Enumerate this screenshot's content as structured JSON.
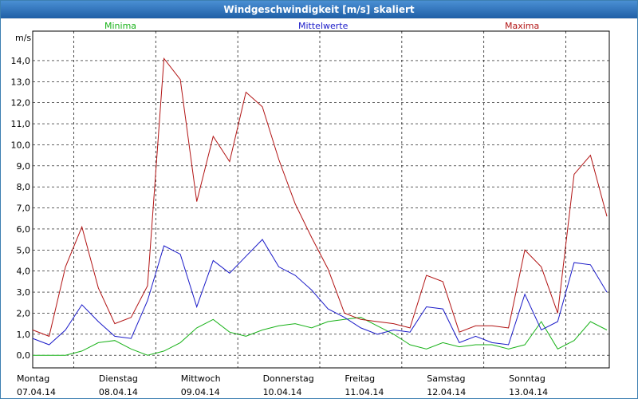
{
  "window": {
    "title": "Windgeschwindigkeit [m/s] skaliert"
  },
  "colors": {
    "min": "#19b219",
    "mean": "#1a1ac8",
    "max": "#b21414",
    "grid": "#000000"
  },
  "chart_data": {
    "type": "line",
    "title": "Windgeschwindigkeit [m/s] skaliert",
    "ylabel": "m/s",
    "ylim": [
      -0.6,
      15.4
    ],
    "yticks": [
      "0,0",
      "1,0",
      "2,0",
      "3,0",
      "4,0",
      "5,0",
      "6,0",
      "7,0",
      "8,0",
      "9,0",
      "10,0",
      "11,0",
      "12,0",
      "13,0",
      "14,0"
    ],
    "grid": true,
    "legend_position": "top",
    "day_labels": [
      {
        "weekday": "Montag",
        "date": "07.04.14"
      },
      {
        "weekday": "Dienstag",
        "date": "08.04.14"
      },
      {
        "weekday": "Mittwoch",
        "date": "09.04.14"
      },
      {
        "weekday": "Donnerstag",
        "date": "10.04.14"
      },
      {
        "weekday": "Freitag",
        "date": "11.04.14"
      },
      {
        "weekday": "Samstag",
        "date": "12.04.14"
      },
      {
        "weekday": "Sonntag",
        "date": "13.04.14"
      }
    ],
    "series": [
      {
        "name": "Minima",
        "key": "min",
        "x": [
          0,
          0.2,
          0.4,
          0.6,
          0.8,
          1,
          1.2,
          1.4,
          1.6,
          1.8,
          2,
          2.2,
          2.4,
          2.6,
          2.8,
          3,
          3.2,
          3.4,
          3.6,
          3.8,
          4,
          4.2,
          4.4,
          4.6,
          4.8,
          5,
          5.2,
          5.4,
          5.6,
          5.8,
          6,
          6.2,
          6.4,
          6.6,
          6.8,
          7
        ],
        "y": [
          0,
          0,
          0,
          0.2,
          0.6,
          0.7,
          0.3,
          0,
          0.2,
          0.6,
          1.3,
          1.7,
          1.1,
          0.9,
          1.2,
          1.4,
          1.5,
          1.3,
          1.6,
          1.7,
          1.8,
          1.4,
          1.0,
          0.5,
          0.3,
          0.6,
          0.4,
          0.5,
          0.5,
          0.3,
          0.5,
          1.6,
          0.3,
          0.7,
          1.6,
          1.2
        ]
      },
      {
        "name": "Mittelwerte",
        "key": "mean",
        "x": [
          0,
          0.2,
          0.4,
          0.6,
          0.8,
          1,
          1.2,
          1.4,
          1.6,
          1.8,
          2,
          2.2,
          2.4,
          2.6,
          2.8,
          3,
          3.2,
          3.4,
          3.6,
          3.8,
          4,
          4.2,
          4.4,
          4.6,
          4.8,
          5,
          5.2,
          5.4,
          5.6,
          5.8,
          6,
          6.2,
          6.4,
          6.6,
          6.8,
          7
        ],
        "y": [
          0.8,
          0.5,
          1.2,
          2.4,
          1.6,
          0.9,
          0.8,
          2.6,
          5.2,
          4.8,
          2.3,
          4.5,
          3.9,
          4.7,
          5.5,
          4.2,
          3.8,
          3.1,
          2.2,
          1.8,
          1.3,
          1.0,
          1.2,
          1.1,
          2.3,
          2.2,
          0.6,
          0.9,
          0.6,
          0.5,
          2.9,
          1.2,
          1.6,
          4.4,
          4.3,
          3.0
        ]
      },
      {
        "name": "Maxima",
        "key": "max",
        "x": [
          0,
          0.2,
          0.4,
          0.6,
          0.8,
          1,
          1.2,
          1.4,
          1.6,
          1.8,
          2,
          2.2,
          2.4,
          2.6,
          2.8,
          3,
          3.2,
          3.4,
          3.6,
          3.8,
          4,
          4.2,
          4.4,
          4.6,
          4.8,
          5,
          5.2,
          5.4,
          5.6,
          5.8,
          6,
          6.2,
          6.4,
          6.6,
          6.8,
          7
        ],
        "y": [
          1.2,
          0.9,
          4.2,
          6.1,
          3.2,
          1.5,
          1.8,
          3.3,
          14.1,
          13.1,
          7.3,
          10.4,
          9.2,
          12.5,
          11.8,
          9.3,
          7.2,
          5.6,
          4.1,
          2.0,
          1.7,
          1.6,
          1.5,
          1.3,
          3.8,
          3.5,
          1.1,
          1.4,
          1.4,
          1.3,
          5.0,
          4.2,
          2.0,
          8.6,
          9.5,
          6.6
        ]
      }
    ]
  }
}
